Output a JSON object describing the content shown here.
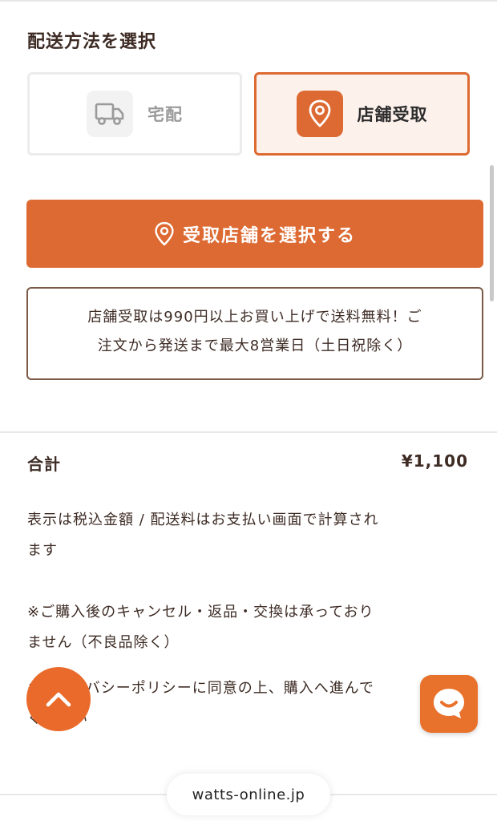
{
  "shipping": {
    "section_title": "配送方法を選択",
    "options": [
      {
        "label": "宅配",
        "icon": "truck-icon",
        "selected": false
      },
      {
        "label": "店舗受取",
        "icon": "location-pin-icon",
        "selected": true
      }
    ]
  },
  "store_select": {
    "button_label": "受取店舗を選択する",
    "icon": "location-pin-icon"
  },
  "notice": {
    "line1": "店舗受取は990円以上お買い上げで送料無料！ご",
    "line2": "注文から発送まで最大8営業日（土日祝除く）"
  },
  "summary": {
    "total_label": "合計",
    "total_value": "¥1,100",
    "tax_note_line1": "表示は税込金額 / 配送料はお支払い画面で計算され",
    "tax_note_line2": "ます",
    "cancel_note_line1": "※ご購入後のキャンセル・返品・交換は承っており",
    "cancel_note_line2": "ません（不良品除く）",
    "privacy_note_line1": "※プライバシーポリシーに同意の上、購入へ進んで",
    "privacy_note_line2": "ください"
  },
  "floating": {
    "scroll_top_icon": "chevron-up-icon",
    "chat_icon": "chat-smile-icon"
  },
  "browser": {
    "url": "watts-online.jp"
  },
  "colors": {
    "accent": "#dd6a32",
    "selected_bg": "#fdf1ec",
    "text": "#3d2b24",
    "notice_border": "#7a5a47"
  }
}
